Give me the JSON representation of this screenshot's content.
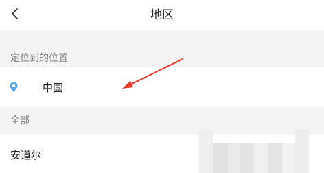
{
  "header": {
    "back_icon": "chevron-left-icon",
    "title": "地区"
  },
  "located_section": {
    "title": "定位到的位置",
    "current": {
      "icon": "location-pin-icon",
      "label": "中国",
      "pin_color": "#5aa9e6"
    }
  },
  "all_section": {
    "title": "全部",
    "items": [
      {
        "label": "安道尔"
      }
    ]
  },
  "annotation": {
    "icon": "red-arrow-icon",
    "color": "#e8362d"
  }
}
